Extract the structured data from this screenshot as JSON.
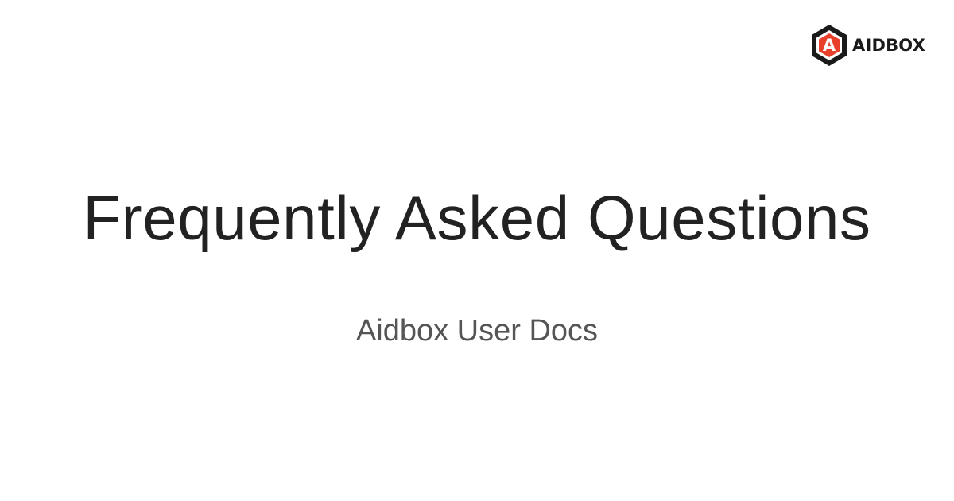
{
  "brand": {
    "name": "AIDBOX",
    "logo_letter": "A",
    "icon": "aidbox-hexagon-logo-icon",
    "mark_color": "#1a1a1a",
    "accent_color": "#e8402a"
  },
  "page": {
    "title": "Frequently Asked Questions",
    "subtitle": "Aidbox User Docs"
  },
  "colors": {
    "background": "#ffffff",
    "title": "#222222",
    "subtitle": "#555555"
  }
}
